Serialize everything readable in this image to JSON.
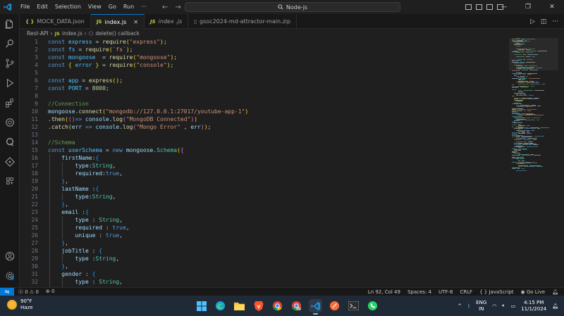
{
  "menu": [
    "File",
    "Edit",
    "Selection",
    "View",
    "Go",
    "Run",
    "···"
  ],
  "search": {
    "text": "Node-js"
  },
  "tabs": [
    {
      "icon": "{ }",
      "label": "MOCK_DATA.json",
      "active": false
    },
    {
      "icon": "JS",
      "label": "index.js",
      "active": true
    },
    {
      "icon": "JS",
      "label": "index .js",
      "active": false
    },
    {
      "icon": "▯",
      "label": "gsoc2024-md-attractor-main.zip",
      "active": false
    }
  ],
  "breadcrumb": {
    "folder": "Rest-API",
    "file": "index.js",
    "symbol": "delete() callback"
  },
  "code_lines": [
    "1",
    "2",
    "3",
    "4",
    "5",
    "6",
    "7",
    "8",
    "9",
    "10",
    "11",
    "12",
    "13",
    "14",
    "15",
    "16",
    "17",
    "18",
    "19",
    "20",
    "21",
    "22",
    "23",
    "24",
    "25",
    "26",
    "27",
    "28",
    "29",
    "30",
    "31",
    "32"
  ],
  "status": {
    "errors": "0",
    "warnings": "0",
    "ports": "0",
    "position": "Ln 92, Col 49",
    "spaces": "Spaces: 4",
    "encoding": "UTF-8",
    "eol": "CRLF",
    "language": "JavaScript",
    "golive": "Go Live"
  },
  "taskbar": {
    "temp": "90°F",
    "weather": "Haze",
    "lang": "ENG",
    "region": "IN",
    "time": "4:15 PM",
    "date": "11/1/2024"
  },
  "colors": {
    "accent": "#0078d4",
    "keyword": "#569cd6",
    "string": "#ce9178",
    "comment": "#6a9955"
  }
}
